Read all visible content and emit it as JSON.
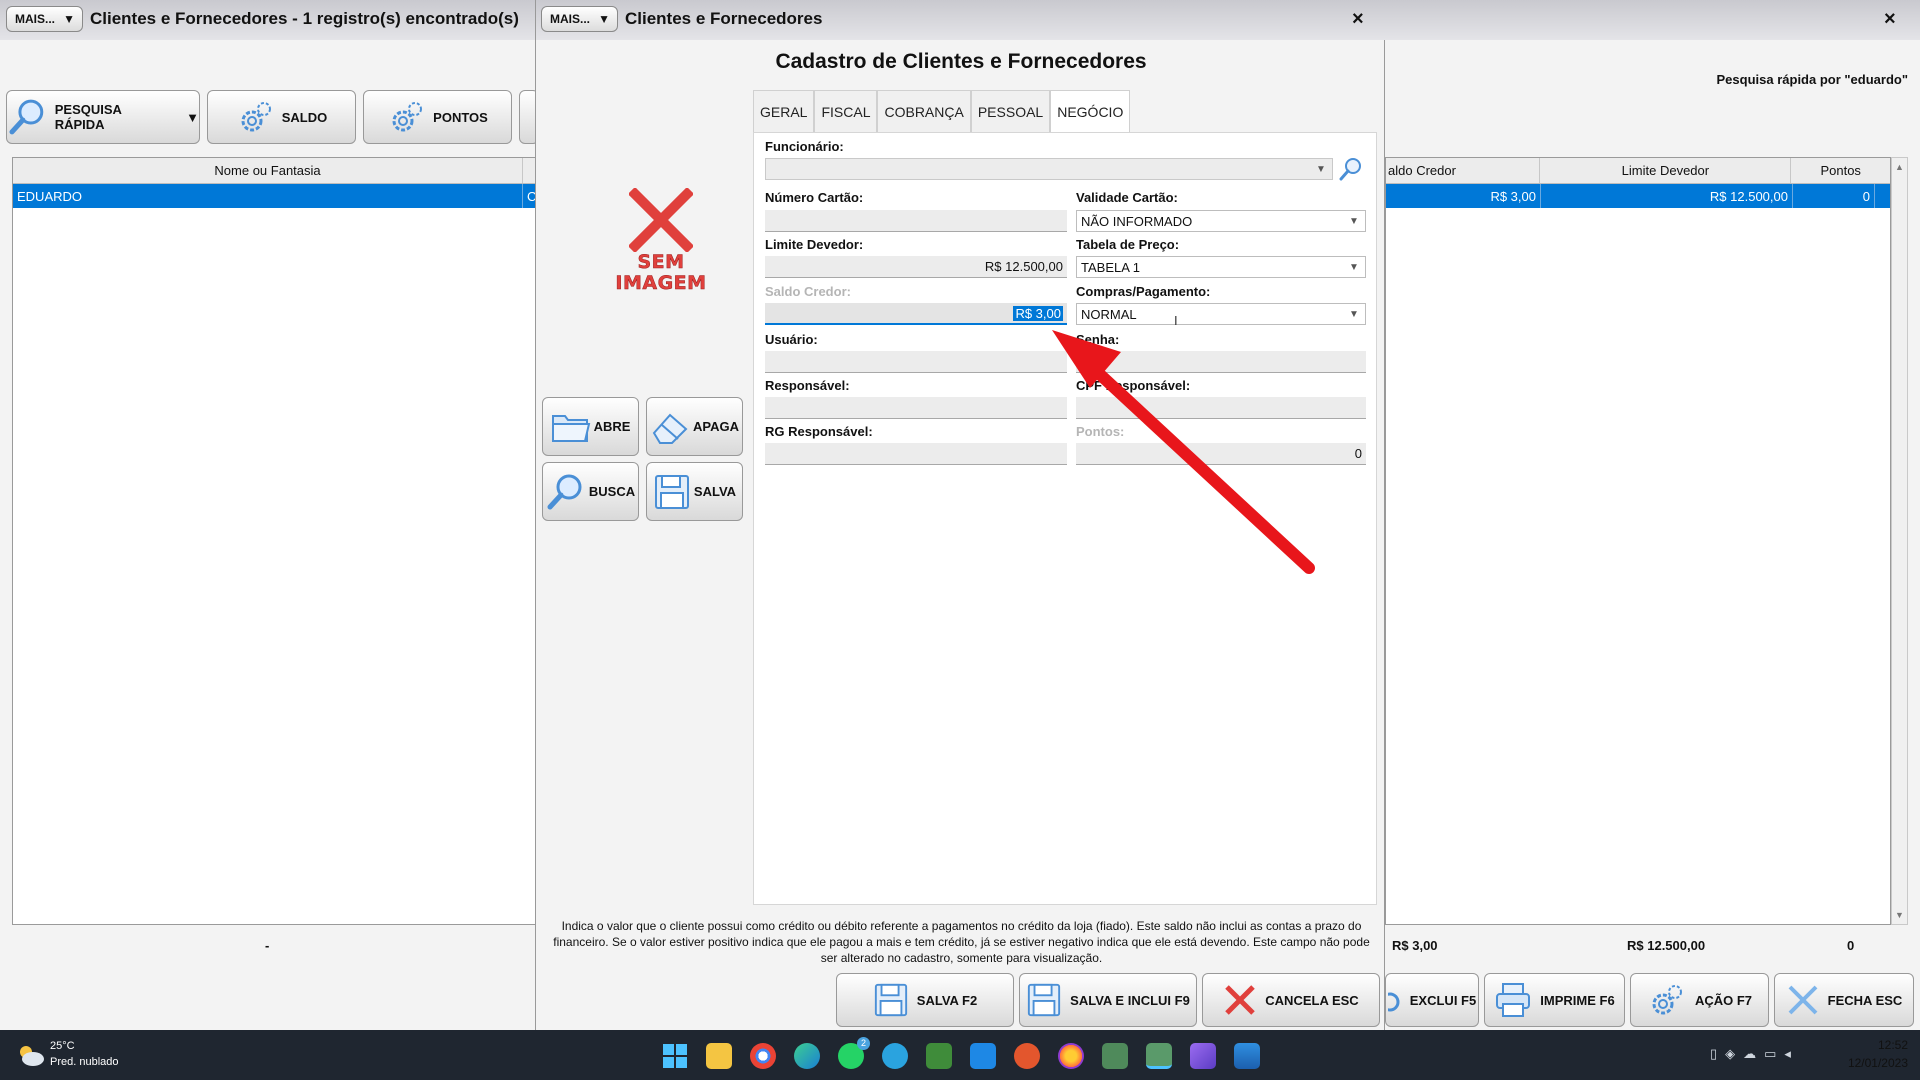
{
  "main_window": {
    "mais_label": "MAIS...",
    "title": "Clientes e Fornecedores - 1 registro(s) encontrado(s)",
    "close": "×",
    "toolbar": {
      "quick_search": "PESQUISA RÁPIDA",
      "balance": "SALDO",
      "points": "PONTOS"
    },
    "quick_search_label": "Pesquisa rápida por \"eduardo\"",
    "grid": {
      "columns": [
        "Nome ou Fantasia",
        "aldo Credor",
        "Limite Devedor",
        "Pontos"
      ],
      "row": {
        "name": "EDUARDO",
        "name_tail": "C",
        "saldo_credor": "R$ 3,00",
        "limite_devedor": "R$ 12.500,00",
        "pontos": "0"
      }
    },
    "totals": {
      "dash": "-",
      "saldo": "R$ 3,00",
      "limite": "R$ 12.500,00",
      "pontos": "0"
    },
    "bottom_buttons": {
      "delete": "EXCLUI F5",
      "print": "IMPRIME F6",
      "action": "AÇÃO F7",
      "close": "FECHA ESC"
    }
  },
  "modal": {
    "mais_label": "MAIS...",
    "title": "Clientes e Fornecedores",
    "close": "×",
    "heading": "Cadastro de Clientes e Fornecedores",
    "no_image_line1": "SEM",
    "no_image_line2": "IMAGEM",
    "side_buttons": {
      "open": "ABRE",
      "erase": "APAGA",
      "search": "BUSCA",
      "save": "SALVA"
    },
    "tabs": [
      "GERAL",
      "FISCAL",
      "COBRANÇA",
      "PESSOAL",
      "NEGÓCIO"
    ],
    "active_tab": "NEGÓCIO",
    "form": {
      "funcionario_label": "Funcionário:",
      "funcionario_value": "",
      "numero_cartao_label": "Número Cartão:",
      "numero_cartao_value": "",
      "validade_cartao_label": "Validade Cartão:",
      "validade_cartao_value": "NÃO INFORMADO",
      "limite_devedor_label": "Limite Devedor:",
      "limite_devedor_value": "R$ 12.500,00",
      "tabela_preco_label": "Tabela de Preço:",
      "tabela_preco_value": "TABELA 1",
      "saldo_credor_label": "Saldo Credor:",
      "saldo_credor_value": "R$ 3,00",
      "compras_pagamento_label": "Compras/Pagamento:",
      "compras_pagamento_value": "NORMAL",
      "usuario_label": "Usuário:",
      "senha_label": "Senha:",
      "responsavel_label": "Responsável:",
      "cpf_responsavel_label": "CPF Responsável:",
      "rg_responsavel_label": "RG Responsável:",
      "pontos_label": "Pontos:",
      "pontos_value": "0"
    },
    "hint_text": "Indica o valor que o cliente possui como crédito ou débito referente a pagamentos no crédito da loja (fiado). Este saldo não inclui as contas a prazo do financeiro. Se o valor estiver positivo indica que ele pagou a mais e tem crédito, já se estiver negativo indica que ele está devendo. Este campo não pode ser alterado no cadastro, somente para visualização.",
    "bottom_buttons": {
      "save": "SALVA F2",
      "save_include": "SALVA E INCLUI F9",
      "cancel": "CANCELA ESC"
    }
  },
  "taskbar": {
    "weather_temp": "25°C",
    "weather_desc": "Pred. nublado",
    "time": "12:52",
    "date": "12/01/2023",
    "whatsapp_badge": "2"
  },
  "colors": {
    "selection": "#0078d7",
    "annotation_arrow": "#e8161b",
    "taskbar": "#1f2630"
  }
}
